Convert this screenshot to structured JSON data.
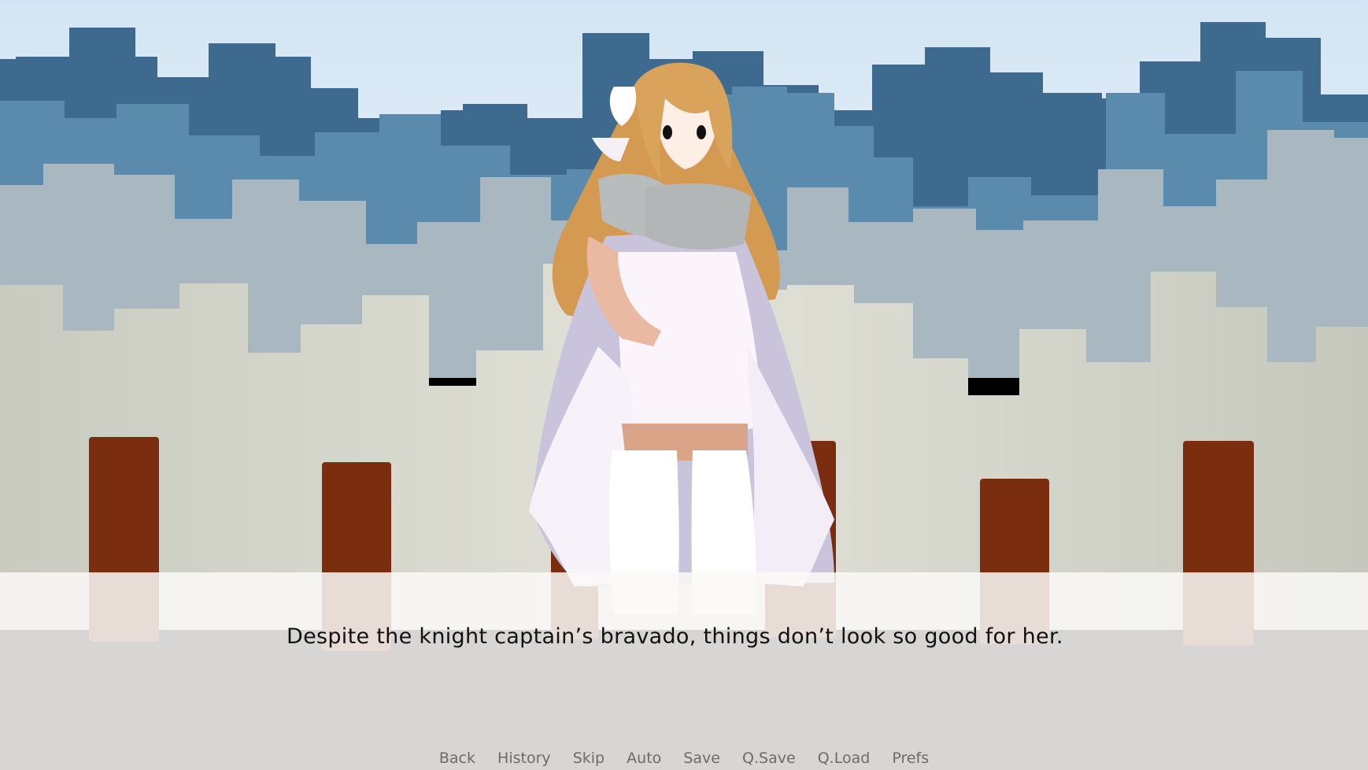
{
  "dialogue": {
    "text": "Despite the knight captain’s bravado, things don’t look so good for her."
  },
  "quick_menu": {
    "back": "Back",
    "history": "History",
    "skip": "Skip",
    "auto": "Auto",
    "save": "Save",
    "qsave": "Q.Save",
    "qload": "Q.Load",
    "prefs": "Prefs"
  },
  "colors": {
    "sky_top": "#d6e6f3",
    "far_buildings": "#3e6f96",
    "mid_buildings": "#aab7c0",
    "near_buildings": "#dcdccf",
    "pillars": "#7a2e12",
    "hair": "#d9a35c",
    "dress": "#fbf5fb",
    "textbox": "#faf9f7"
  }
}
